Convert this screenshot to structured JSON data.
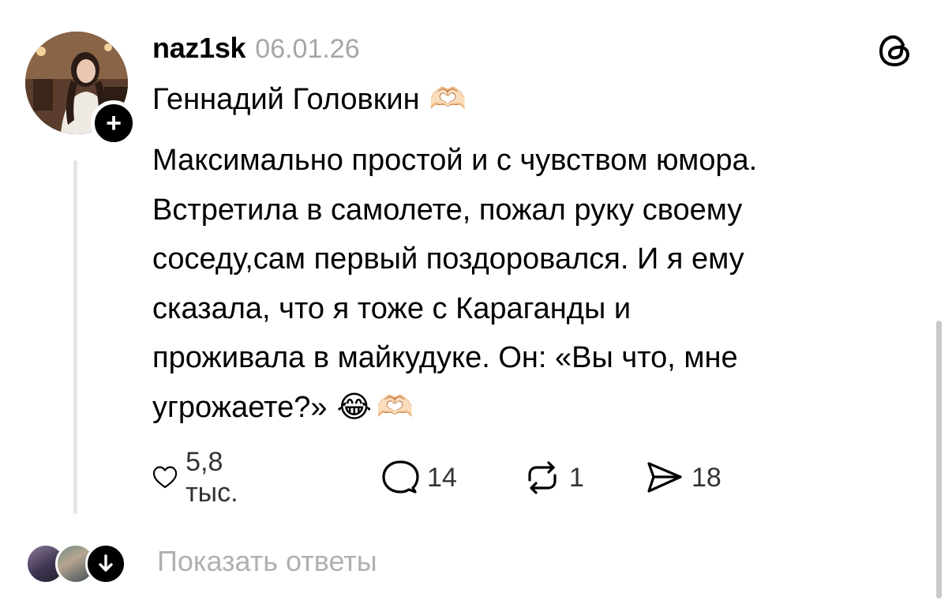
{
  "post": {
    "username": "naz1sk",
    "date": "06.01.26",
    "title": "Геннадий Головкин",
    "title_emoji": "🫶🏻",
    "body_lines": [
      "Максимально простой и с чувством юмора.",
      "Встретила в самолете, пожал руку своему",
      "соседу,сам первый поздоровался. И я ему",
      "сказала, что я тоже с Караганды и",
      "проживала в майкудуке. Он: «Вы что, мне",
      "угрожаете?»"
    ],
    "ending_emojis": [
      "😂",
      "🫶🏻"
    ]
  },
  "follow_button": {
    "label": "+"
  },
  "actions": {
    "likes": "5,8 тыс.",
    "comments": "14",
    "reposts": "1",
    "shares": "18"
  },
  "replies": {
    "label": "Показать ответы"
  },
  "icons": {
    "like": "heart-icon",
    "comment": "speech-bubble-icon",
    "repost": "repost-icon",
    "share": "send-icon",
    "logo": "threads-logo-icon",
    "expand": "arrow-down-icon"
  }
}
